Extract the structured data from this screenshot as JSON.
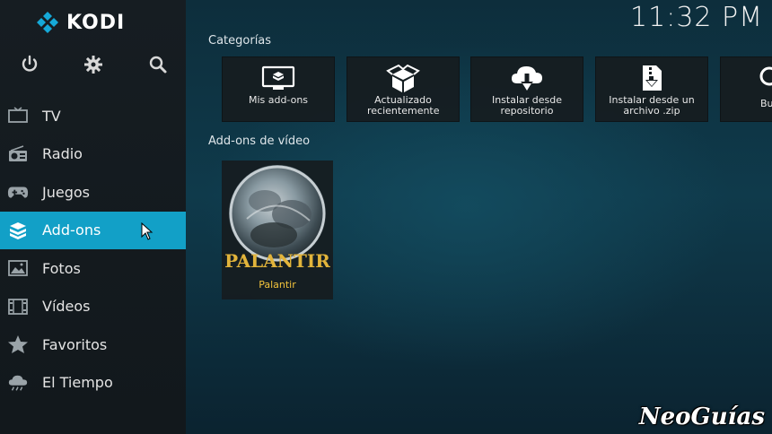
{
  "app": {
    "logo_text": "KODI",
    "clock": "11:32 PM"
  },
  "top_icons": [
    "power-icon",
    "gear-icon",
    "search-icon"
  ],
  "menu": {
    "items": [
      {
        "label": "TV",
        "icon": "tv-icon",
        "active": false
      },
      {
        "label": "Radio",
        "icon": "radio-icon",
        "active": false
      },
      {
        "label": "Juegos",
        "icon": "gamepad-icon",
        "active": false
      },
      {
        "label": "Add-ons",
        "icon": "addons-box-icon",
        "active": true
      },
      {
        "label": "Fotos",
        "icon": "photo-icon",
        "active": false
      },
      {
        "label": "Vídeos",
        "icon": "film-icon",
        "active": false
      },
      {
        "label": "Favoritos",
        "icon": "star-icon",
        "active": false
      },
      {
        "label": "El Tiempo",
        "icon": "weather-icon",
        "active": false
      }
    ]
  },
  "categories": {
    "title": "Categorías",
    "tiles": [
      {
        "label": "Mis add-ons",
        "icon": "monitor-box-icon"
      },
      {
        "label": "Actualizado recientemente",
        "icon": "open-box-icon"
      },
      {
        "label": "Instalar desde repositorio",
        "icon": "cloud-download-icon"
      },
      {
        "label": "Instalar desde un archivo .zip",
        "icon": "zip-download-icon"
      },
      {
        "label": "Bu",
        "icon": "search-icon"
      }
    ]
  },
  "video_addons": {
    "title": "Add-ons de vídeo",
    "items": [
      {
        "label": "Palantir",
        "art_title": "PALANTIR"
      }
    ]
  },
  "watermark": "NeoGuías",
  "colors": {
    "accent": "#12a0c7",
    "addon_label": "#f2c33c"
  }
}
